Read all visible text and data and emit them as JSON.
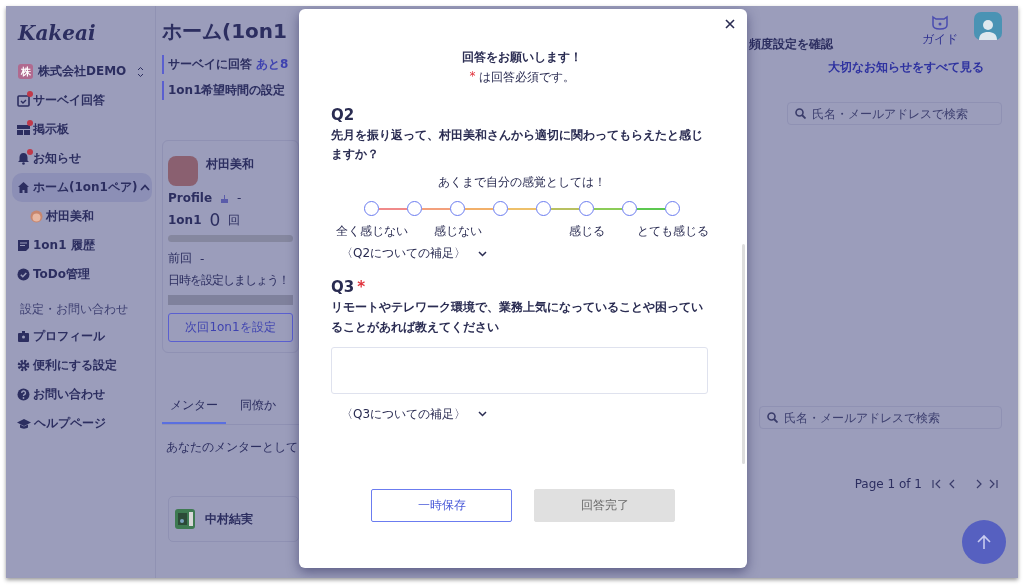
{
  "sidebar": {
    "logo": "Kakeai",
    "org": {
      "badge": "株",
      "name": "株式会社DEMO"
    },
    "items": [
      {
        "label": "サーベイ回答",
        "badge": true,
        "selected": false
      },
      {
        "label": "掲示板",
        "badge": true,
        "selected": false
      },
      {
        "label": "お知らせ",
        "badge": true,
        "selected": false
      },
      {
        "label": "ホーム(1on1ペア)",
        "badge": false,
        "selected": true,
        "expanded": true,
        "children": [
          {
            "label": "村田美和",
            "badge": false,
            "selected": false
          }
        ]
      },
      {
        "label": "1on1 履歴",
        "badge": false,
        "selected": false
      },
      {
        "label": "ToDo管理",
        "badge": false,
        "selected": false
      }
    ],
    "section_label": "設定・お問い合わせ",
    "settings_items": [
      {
        "label": "プロフィール",
        "badge": false,
        "selected": false
      },
      {
        "label": "便利にする設定",
        "badge": false,
        "selected": false
      },
      {
        "label": "お問い合わせ",
        "badge": false,
        "selected": false
      },
      {
        "label": "ヘルプページ",
        "badge": false,
        "selected": false
      }
    ]
  },
  "page": {
    "title": "ホーム(1on1",
    "notice_links": [
      {
        "label": "サーベイに回答",
        "extra": "あと8"
      },
      {
        "label": "1on1希望時間の設定"
      }
    ],
    "frequency_link": "頻度設定を確認",
    "all_notices_link": "大切なお知らせをすべて見る",
    "pair_card": {
      "name": "村田美和",
      "profile_label": "Profile",
      "profile_value": "-",
      "count_label": "1on1",
      "count": "0",
      "count_unit": "回",
      "last_label": "前回",
      "last_value": "-",
      "hint": "日時を設定しましょう！",
      "button": "次回1on1を設定"
    },
    "tabs": [
      {
        "label": "メンター",
        "selected": true
      },
      {
        "label": "同僚か",
        "selected": false
      }
    ],
    "tab_text": "あなたのメンターとして",
    "search_fields": [
      {
        "placeholder": "氏名・メールアドレスで検索"
      },
      {
        "placeholder": "氏名・メールアドレスで検索"
      }
    ],
    "mentor_card": {
      "name": "中村結実"
    },
    "pagination": "Page 1 of 1",
    "guide_label": "ガイド"
  },
  "modal": {
    "title": "回答をお願いします！",
    "required_mark": "*",
    "required_note": "は回答必須です。",
    "questions": [
      {
        "kind": "scale",
        "number": "Q2",
        "required": false,
        "text": "先月を振り返って、村田美和さんから適切に関わってもらえたと感じますか？",
        "hint": "あくまで自分の感覚としては！",
        "options": [
          {
            "label": "全く感じない",
            "selected": false
          },
          {
            "selected": false
          },
          {
            "label": "感じない",
            "selected": false
          },
          {
            "selected": false
          },
          {
            "selected": false
          },
          {
            "label": "感じる",
            "selected": false
          },
          {
            "selected": false
          },
          {
            "label": "とても感じる",
            "selected": false
          }
        ],
        "connectors": [
          {
            "color": "#f08a8a"
          },
          {
            "color": "#f3a07c"
          },
          {
            "color": "#f2b06a"
          },
          {
            "color": "#eec06a"
          },
          {
            "color": "#b8c060"
          },
          {
            "color": "#8ccc58"
          },
          {
            "color": "#5cc850"
          }
        ],
        "supplement": "〈Q2についての補足〉"
      },
      {
        "kind": "text",
        "number": "Q3",
        "required": true,
        "text": "リモートやテレワーク環境で、業務上気になっていることや困っていることがあれば教えてください",
        "supplement": "〈Q3についての補足〉"
      }
    ],
    "buttons": [
      {
        "label": "一時保存",
        "disabled": false
      },
      {
        "label": "回答完了",
        "disabled": true
      }
    ]
  }
}
